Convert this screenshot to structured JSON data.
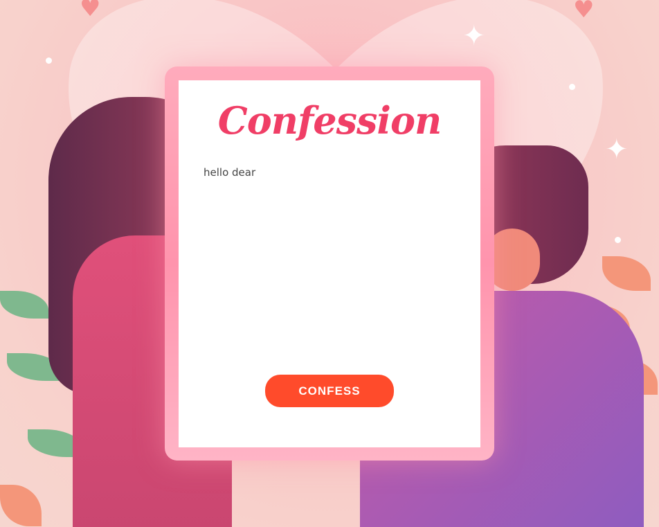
{
  "card": {
    "title": "Confession",
    "message_value": "hello dear",
    "confess_label": "CONFESS"
  },
  "colors": {
    "accent": "#ff4b2b",
    "title": "#f03e66",
    "frame": "#ff9bb2"
  }
}
